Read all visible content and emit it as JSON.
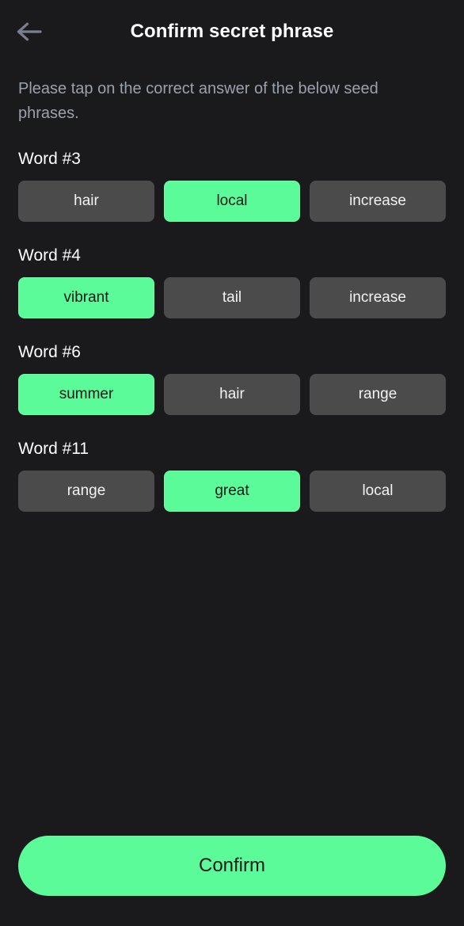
{
  "header": {
    "title": "Confirm secret phrase",
    "back_icon": "arrow-left-icon"
  },
  "subtitle": "Please tap on the correct answer of the below seed phrases.",
  "colors": {
    "background": "#1a1a1c",
    "accent_green": "#5cfb9a",
    "option_gray": "#4b4b4b",
    "title_white": "#ffffff",
    "subtitle_gray": "#9ba1ab",
    "back_arrow_gray": "#7a8090"
  },
  "groups": [
    {
      "label": "Word #3",
      "options": [
        {
          "text": "hair",
          "selected": false
        },
        {
          "text": "local",
          "selected": true
        },
        {
          "text": "increase",
          "selected": false
        }
      ]
    },
    {
      "label": "Word #4",
      "options": [
        {
          "text": "vibrant",
          "selected": true
        },
        {
          "text": "tail",
          "selected": false
        },
        {
          "text": "increase",
          "selected": false
        }
      ]
    },
    {
      "label": "Word #6",
      "options": [
        {
          "text": "summer",
          "selected": true
        },
        {
          "text": "hair",
          "selected": false
        },
        {
          "text": "range",
          "selected": false
        }
      ]
    },
    {
      "label": "Word #11",
      "options": [
        {
          "text": "range",
          "selected": false
        },
        {
          "text": "great",
          "selected": true
        },
        {
          "text": "local",
          "selected": false
        }
      ]
    }
  ],
  "footer": {
    "confirm_label": "Confirm"
  }
}
